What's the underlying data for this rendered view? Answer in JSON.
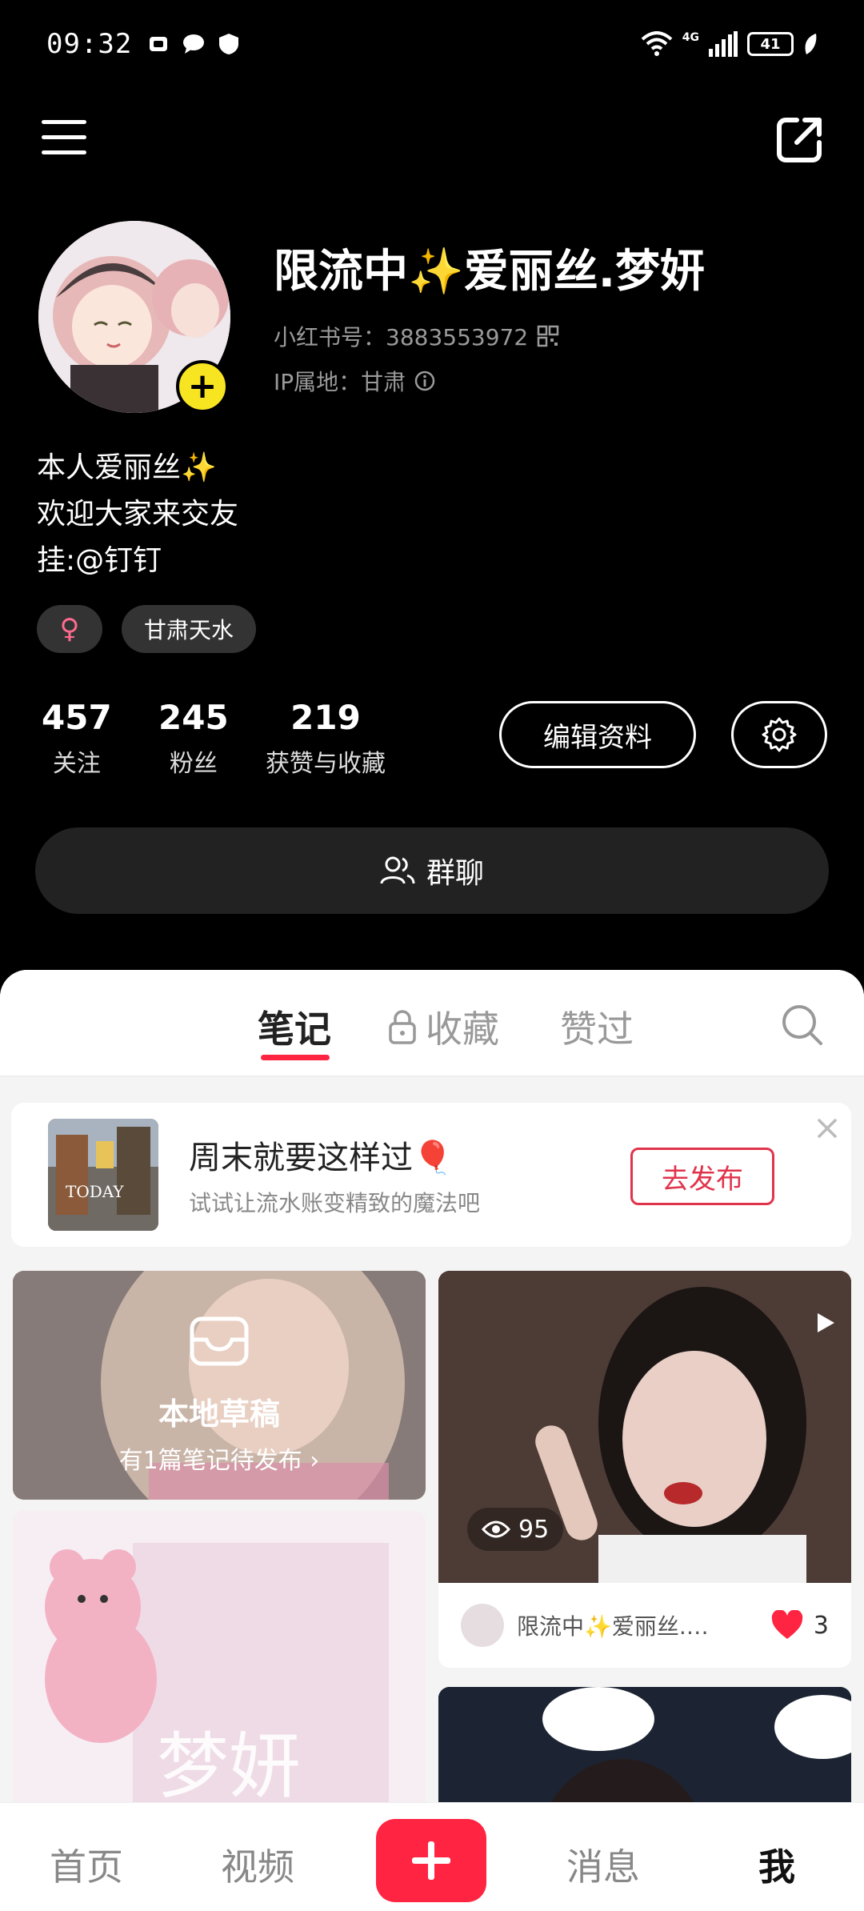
{
  "status_bar": {
    "time": "09:32",
    "network": "4G",
    "battery": "41"
  },
  "profile": {
    "name": "限流中✨爱丽丝.梦妍",
    "red_id": "小红书号：3883553972",
    "ip_location": "IP属地：甘肃",
    "bio_lines": [
      "本人爱丽丝✨",
      "欢迎大家来交友",
      "挂:@钉钉"
    ],
    "gender_symbol": "♀",
    "location_tag": "甘肃天水"
  },
  "stats": [
    {
      "value": "457",
      "label": "关注"
    },
    {
      "value": "245",
      "label": "粉丝"
    },
    {
      "value": "219",
      "label": "获赞与收藏"
    }
  ],
  "actions": {
    "edit_profile": "编辑资料",
    "group_chat": "群聊"
  },
  "tabs": [
    {
      "label": "笔记",
      "active": true
    },
    {
      "label": "收藏",
      "locked": true
    },
    {
      "label": "赞过"
    }
  ],
  "promo": {
    "title": "周末就要这样过🎈",
    "subtitle": "试试让流水账变精致的魔法吧",
    "button": "去发布",
    "thumb_text": "TODAY"
  },
  "draft": {
    "title": "本地草稿",
    "subtitle": "有1篇笔记待发布 ›"
  },
  "notes": [
    {
      "views": "95",
      "author": "限流中✨爱丽丝.梦妍",
      "author_display": "限流中✨爱丽丝.…",
      "likes": "3"
    }
  ],
  "cover_text": "梦妍",
  "bottom_nav": {
    "home": "首页",
    "video": "视频",
    "messages": "消息",
    "me": "我"
  },
  "colors": {
    "accent": "#ff2442",
    "avatar_badge": "#f7e521",
    "background_top": "#000000"
  }
}
